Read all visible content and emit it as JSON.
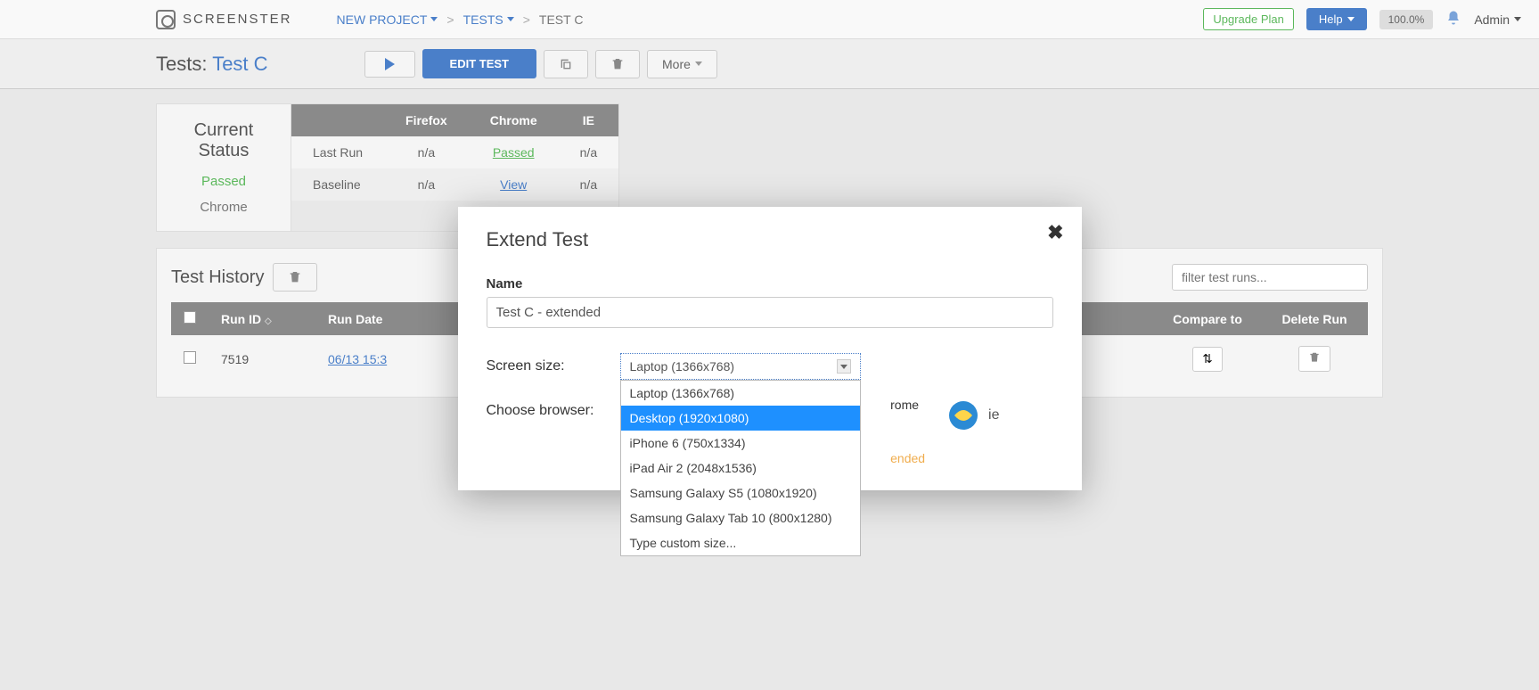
{
  "app": {
    "name": "SCREENSTER"
  },
  "breadcrumbs": {
    "project": "NEW PROJECT",
    "tests": "TESTS",
    "current": "TEST C"
  },
  "topRight": {
    "upgrade": "Upgrade Plan",
    "help": "Help",
    "pct": "100.0%",
    "admin": "Admin"
  },
  "pageTitle": {
    "prefix": "Tests:",
    "name": "Test C"
  },
  "toolbar": {
    "edit": "EDIT TEST",
    "more": "More"
  },
  "status": {
    "cardTitle": "Current Status",
    "passed": "Passed",
    "browser": "Chrome",
    "cols": [
      "Firefox",
      "Chrome",
      "IE"
    ],
    "rows": [
      {
        "label": "Last Run",
        "firefox": "n/a",
        "chrome": "Passed",
        "ie": "n/a"
      },
      {
        "label": "Baseline",
        "firefox": "n/a",
        "chrome": "View",
        "ie": "n/a"
      }
    ]
  },
  "history": {
    "title": "Test History",
    "filterPlaceholder": "filter test runs...",
    "cols": {
      "runId": "Run ID",
      "runDate": "Run Date",
      "compare": "Compare to",
      "delete": "Delete Run"
    },
    "row": {
      "runId": "7519",
      "runDate": "06/13 15:3"
    }
  },
  "modal": {
    "title": "Extend Test",
    "nameLabel": "Name",
    "nameValue": "Test C - extended",
    "screenSizeLabel": "Screen size:",
    "selected": "Laptop (1366x768)",
    "options": [
      "Laptop (1366x768)",
      "Desktop (1920x1080)",
      "iPhone 6 (750x1334)",
      "iPad Air 2 (2048x1536)",
      "Samsung Galaxy S5 (1080x1920)",
      "Samsung Galaxy Tab 10 (800x1280)",
      "Type custom size..."
    ],
    "highlightedIndex": 1,
    "browserLabel": "Choose browser:",
    "browsers": {
      "chrome": "rome",
      "ie": "ie"
    },
    "extendedHint": "ended"
  }
}
